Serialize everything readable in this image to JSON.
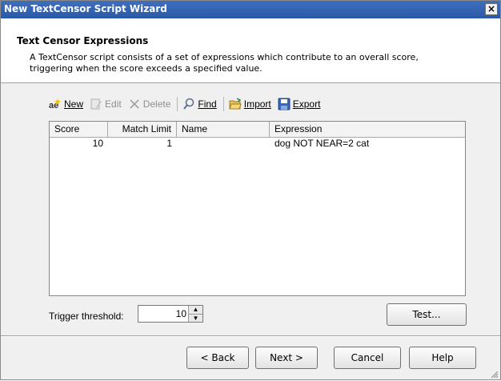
{
  "window": {
    "title": "New TextCensor Script Wizard",
    "close_glyph": "×"
  },
  "header": {
    "title": "Text Censor Expressions",
    "description": "A TextCensor script consists of a set of expressions which contribute to an overall score, triggering when the score exceeds a specified value."
  },
  "toolbar": {
    "new": {
      "label": "New",
      "icon": "new-expression-icon",
      "enabled": true
    },
    "edit": {
      "label": "Edit",
      "icon": "edit-document-icon",
      "enabled": false
    },
    "delete": {
      "label": "Delete",
      "icon": "delete-x-icon",
      "enabled": false
    },
    "find": {
      "label": "Find",
      "icon": "magnifier-icon",
      "enabled": true
    },
    "import": {
      "label": "Import",
      "icon": "open-folder-icon",
      "enabled": true
    },
    "export": {
      "label": "Export",
      "icon": "save-disk-icon",
      "enabled": true
    }
  },
  "table": {
    "columns": [
      "Score",
      "Match Limit",
      "Name",
      "Expression"
    ],
    "rows": [
      {
        "score": "10",
        "match_limit": "1",
        "name": "",
        "expression": "dog NOT NEAR=2 cat"
      }
    ]
  },
  "trigger": {
    "label": "Trigger threshold:",
    "value": "10"
  },
  "buttons": {
    "test": "Test...",
    "back": "< Back",
    "next": "Next >",
    "cancel": "Cancel",
    "help": "Help"
  },
  "colors": {
    "titlebar": "#2a58a8",
    "dialog_bg": "#f0f0f0"
  }
}
